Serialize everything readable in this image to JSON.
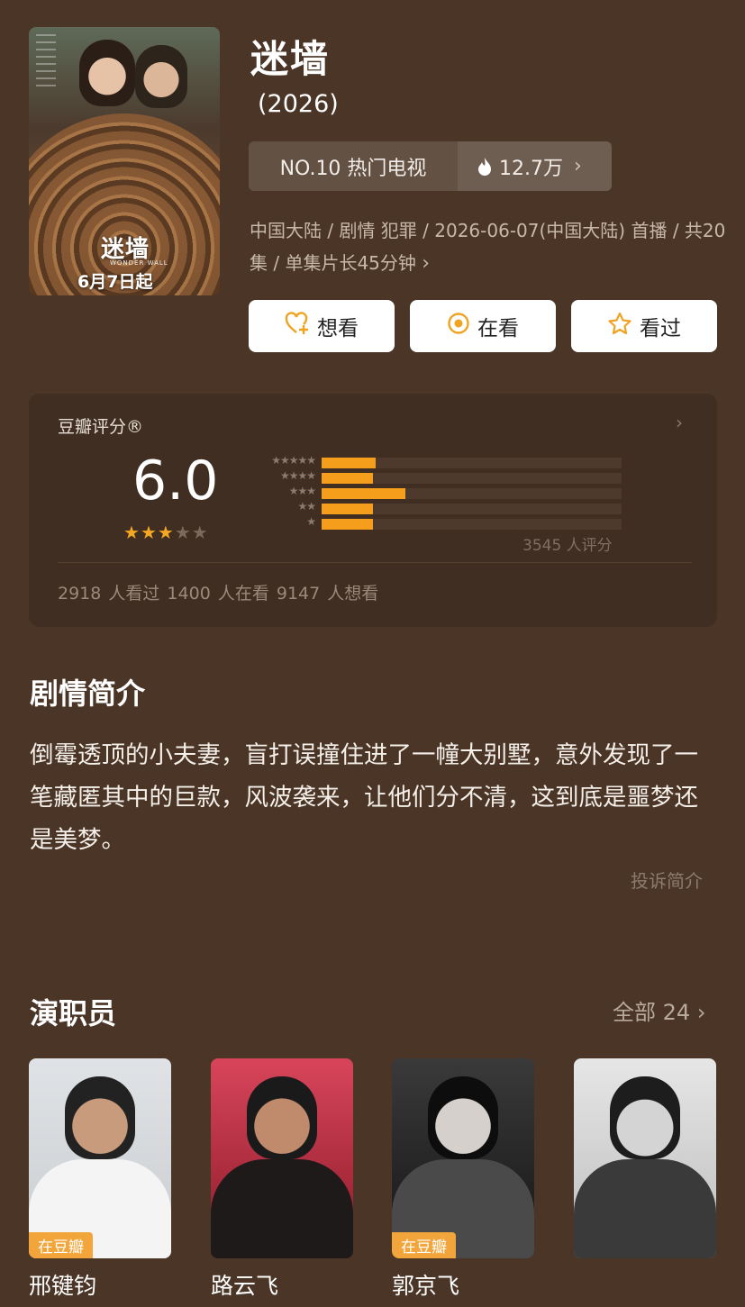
{
  "movie": {
    "title": "迷墙",
    "year": "(2026)",
    "poster": {
      "title": "迷墙",
      "subtitle": "WONDER WALL",
      "date": "6月7日起"
    }
  },
  "rank": {
    "label": "NO.10 热门电视",
    "heat": "12.7万"
  },
  "meta": {
    "line": "中国大陆 / 剧情 犯罪 / 2026-06-07(中国大陆) 首播 / 共20集 / 单集片长45分钟"
  },
  "actions": [
    {
      "label": "想看",
      "icon": "heart-plus-icon"
    },
    {
      "label": "在看",
      "icon": "target-icon"
    },
    {
      "label": "看过",
      "icon": "star-outline-icon"
    }
  ],
  "rating": {
    "label": "豆瓣评分®",
    "score": "6.0",
    "stars_filled": 3,
    "stars_total": 5,
    "distribution": [
      {
        "stars": "★★★★★",
        "fraction": 0.18
      },
      {
        "stars": "★★★★",
        "fraction": 0.17
      },
      {
        "stars": "★★★",
        "fraction": 0.28
      },
      {
        "stars": "★★",
        "fraction": 0.17
      },
      {
        "stars": "★",
        "fraction": 0.17
      }
    ],
    "count_text": "3545 人评分",
    "stats": "2918 人看过    1400 人在看    9147 人想看"
  },
  "synopsis": {
    "heading": "剧情简介",
    "text": "倒霉透顶的小夫妻，盲打误撞住进了一幢大别墅，意外发现了一笔藏匿其中的巨款，风波袭来，让他们分不清，这到底是噩梦还是美梦。",
    "report": "投诉简介"
  },
  "cast": {
    "heading": "演职员",
    "all_label": "全部 24",
    "members": [
      {
        "name": "邢键钧",
        "badge": "在豆瓣"
      },
      {
        "name": "路云飞",
        "badge": ""
      },
      {
        "name": "郭京飞",
        "badge": "在豆瓣"
      },
      {
        "name": "",
        "badge": ""
      }
    ]
  }
}
